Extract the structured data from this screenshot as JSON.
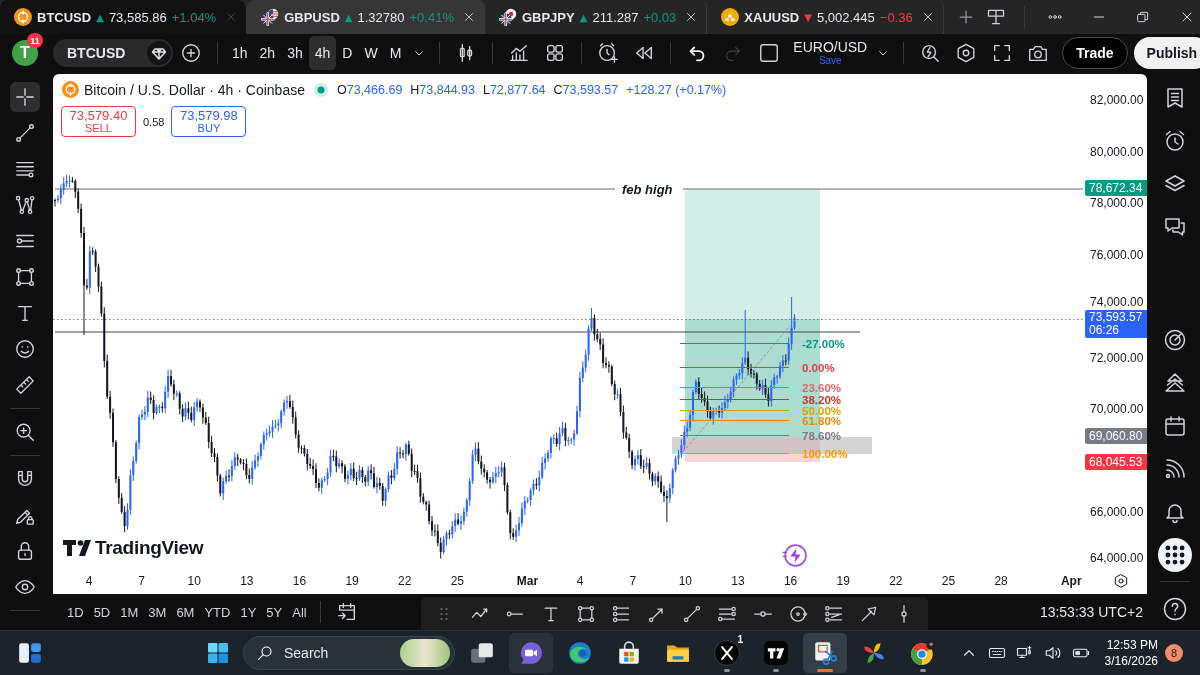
{
  "tabs": [
    {
      "kind": "coin",
      "symbol": "BTCUSD",
      "arrow": "▲",
      "price": "73,585.86",
      "change": "+1.04%",
      "color": "#089981",
      "selected": true,
      "hovered": false
    },
    {
      "kind": "flags-us",
      "symbol": "GBPUSD",
      "arrow": "▲",
      "price": "1.32780",
      "change": "+0.41%",
      "color": "#089981",
      "selected": false,
      "hovered": true
    },
    {
      "kind": "flags-jp",
      "symbol": "GBPJPY",
      "arrow": "▲",
      "price": "211.287",
      "change": "+0.03",
      "color": "#089981",
      "selected": false,
      "hovered": false
    },
    {
      "kind": "gold",
      "symbol": "XAUUSD",
      "arrow": "▼",
      "price": "5,002.445",
      "change": "−0.36",
      "color": "#f23645",
      "selected": false,
      "hovered": false
    }
  ],
  "toolbar": {
    "avatar": {
      "letter": "T",
      "badge": "11"
    },
    "symbol": "BTCUSD",
    "intervals": [
      {
        "label": "1h",
        "selected": false
      },
      {
        "label": "2h",
        "selected": false
      },
      {
        "label": "3h",
        "selected": false
      },
      {
        "label": "4h",
        "selected": true
      },
      {
        "label": "D",
        "selected": false
      },
      {
        "label": "W",
        "selected": false
      },
      {
        "label": "M",
        "selected": false
      }
    ],
    "history": [
      {
        "kind": "undo",
        "disabled": false
      },
      {
        "kind": "redo",
        "disabled": true
      }
    ],
    "layout": {
      "name": "EURO/USD",
      "status": "Save"
    },
    "buttons": [
      {
        "kind": "outline",
        "label": "Trade"
      },
      {
        "kind": "filled",
        "label": "Publish"
      }
    ]
  },
  "left_tools": [
    [
      {
        "kind": "crosshair",
        "selected": true
      },
      {
        "kind": "trend-line",
        "selected": false
      },
      {
        "kind": "fib-lines",
        "selected": false
      },
      {
        "kind": "pattern",
        "selected": false
      },
      {
        "kind": "forecast",
        "selected": false
      },
      {
        "kind": "rectangle",
        "selected": false
      },
      {
        "kind": "text",
        "selected": false
      },
      {
        "kind": "smiley",
        "selected": false
      },
      {
        "kind": "ruler",
        "selected": false
      }
    ],
    [
      {
        "kind": "zoom",
        "selected": false
      }
    ],
    [
      {
        "kind": "magnet",
        "selected": false
      },
      {
        "kind": "draw-lock",
        "selected": false
      },
      {
        "kind": "lock",
        "selected": false
      },
      {
        "kind": "eye",
        "selected": false
      }
    ]
  ],
  "chart": {
    "title": "Bitcoin / U.S. Dollar · 4h · Coinbase",
    "market_open": true,
    "ohlc": [
      {
        "key": "O",
        "value": "73,466.69"
      },
      {
        "key": "H",
        "value": "73,844.93"
      },
      {
        "key": "L",
        "value": "72,877.64"
      },
      {
        "key": "C",
        "value": "73,593.57"
      }
    ],
    "change": "+128.27 (+0.17%)",
    "quote": [
      {
        "kind": "sell",
        "price": "73,579.40",
        "label": "SELL"
      },
      {
        "kind": "buy",
        "price": "73,579.98",
        "label": "BUY"
      }
    ],
    "spread": "0.58",
    "line_label": "feb high",
    "fib_levels": [
      {
        "label": "-27.00%",
        "color": "#089981"
      },
      {
        "label": "0.00%",
        "color": "#e03c48"
      },
      {
        "label": "23.60%",
        "color": "#e8606c"
      },
      {
        "label": "38.20%",
        "color": "#d32f2f"
      },
      {
        "label": "50.00%",
        "color": "#e0a100"
      },
      {
        "label": "61.80%",
        "color": "#ef8a00"
      },
      {
        "label": "78.60%",
        "color": "#787b86"
      },
      {
        "label": "100.00%",
        "color": "#ff9800"
      }
    ],
    "price_axis": [
      "82,000.00",
      "80,000.00",
      "78,000.00",
      "76,000.00",
      "74,000.00",
      "72,000.00",
      "70,000.00",
      "66,000.00",
      "64,000.00"
    ],
    "price_tags": [
      {
        "value": "78,672.34",
        "color": "#089981"
      },
      {
        "value": "73,593.57",
        "countdown": "06:26",
        "color": "#2962ff"
      },
      {
        "value": "69,060.80",
        "color": "#787b86"
      },
      {
        "value": "68,045.53",
        "color": "#f23645"
      }
    ],
    "time_axis": [
      {
        "label": "4",
        "kind": "day"
      },
      {
        "label": "7",
        "kind": "day"
      },
      {
        "label": "10",
        "kind": "day"
      },
      {
        "label": "13",
        "kind": "day"
      },
      {
        "label": "16",
        "kind": "day"
      },
      {
        "label": "19",
        "kind": "day"
      },
      {
        "label": "22",
        "kind": "day"
      },
      {
        "label": "25",
        "kind": "day"
      },
      {
        "label": "Mar",
        "kind": "month"
      },
      {
        "label": "4",
        "kind": "day"
      },
      {
        "label": "7",
        "kind": "day"
      },
      {
        "label": "10",
        "kind": "day"
      },
      {
        "label": "13",
        "kind": "day"
      },
      {
        "label": "16",
        "kind": "day"
      },
      {
        "label": "19",
        "kind": "day"
      },
      {
        "label": "22",
        "kind": "day"
      },
      {
        "label": "25",
        "kind": "day"
      },
      {
        "label": "28",
        "kind": "day"
      },
      {
        "label": "Apr",
        "kind": "month"
      }
    ],
    "logo": "TradingView"
  },
  "right_tools": [
    [
      {
        "kind": "watchlist"
      },
      {
        "kind": "alarm"
      },
      {
        "kind": "layers"
      },
      {
        "kind": "chat"
      }
    ],
    [
      {
        "kind": "target"
      },
      {
        "kind": "pyramid"
      },
      {
        "kind": "calendar"
      },
      {
        "kind": "broadcast"
      },
      {
        "kind": "bell"
      },
      {
        "kind": "apps"
      }
    ],
    [
      {
        "kind": "help"
      }
    ]
  ],
  "bottom_bar": {
    "ranges": [
      "1D",
      "5D",
      "1M",
      "3M",
      "6M",
      "YTD",
      "1Y",
      "5Y",
      "All"
    ],
    "clock": "13:53:33 UTC+2"
  },
  "taskbar": {
    "search": {
      "placeholder": "Search"
    },
    "apps": [
      {
        "kind": "task-view",
        "running": false,
        "selected": false,
        "hovered": false
      },
      {
        "kind": "video-chat",
        "running": false,
        "selected": false,
        "hovered": true
      },
      {
        "kind": "swirl-browser",
        "running": false,
        "selected": false,
        "hovered": false
      },
      {
        "kind": "store",
        "running": false,
        "selected": false,
        "hovered": false
      },
      {
        "kind": "folder",
        "running": false,
        "selected": false,
        "hovered": false
      },
      {
        "kind": "x-app",
        "badge": "1",
        "running": true,
        "selected": false,
        "hovered": false
      },
      {
        "kind": "chart-app",
        "running": true,
        "selected": false,
        "hovered": false
      },
      {
        "kind": "snip",
        "running": true,
        "selected": true,
        "hovered": false
      },
      {
        "kind": "pinwheel",
        "running": false,
        "selected": false,
        "hovered": false
      },
      {
        "kind": "round-browser",
        "running": true,
        "selected": false,
        "hovered": false
      }
    ],
    "time": "12:53 PM",
    "date": "3/16/2026",
    "notifications": "8"
  }
}
